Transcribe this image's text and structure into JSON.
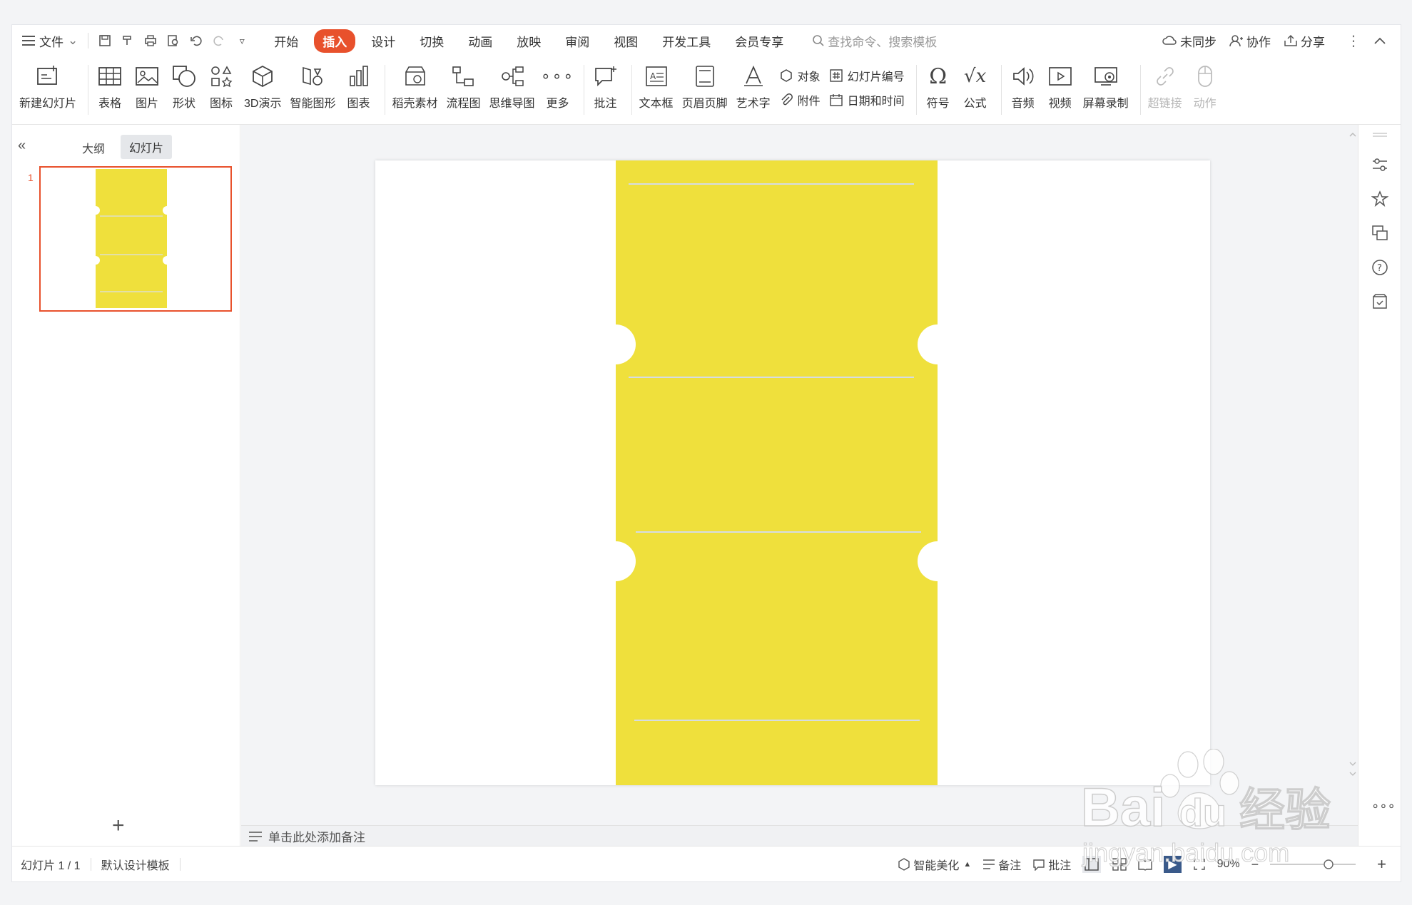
{
  "menubar": {
    "file_label": "文件",
    "tabs": [
      "开始",
      "插入",
      "设计",
      "切换",
      "动画",
      "放映",
      "审阅",
      "视图",
      "开发工具",
      "会员专享"
    ],
    "active_tab": "插入",
    "search_placeholder": "查找命令、搜索模板",
    "right": {
      "sync": "未同步",
      "collab": "协作",
      "share": "分享"
    }
  },
  "ribbon": {
    "new_slide": "新建幻灯片",
    "table": "表格",
    "picture": "图片",
    "shape": "形状",
    "icon": "图标",
    "three_d": "3D演示",
    "smart_graphic": "智能图形",
    "chart": "图表",
    "material": "稻壳素材",
    "flowchart": "流程图",
    "mindmap": "思维导图",
    "more": "更多",
    "comment": "批注",
    "textbox": "文本框",
    "header_footer": "页眉页脚",
    "wordart": "艺术字",
    "object": "对象",
    "slide_number": "幻灯片编号",
    "attachment": "附件",
    "datetime": "日期和时间",
    "symbol": "符号",
    "formula": "公式",
    "audio": "音频",
    "video": "视频",
    "screen_record": "屏幕录制",
    "hyperlink": "超链接",
    "action": "动作"
  },
  "leftpanel": {
    "tab_outline": "大纲",
    "tab_slides": "幻灯片",
    "slide_number": "1",
    "add_symbol": "+"
  },
  "notes": {
    "placeholder": "单击此处添加备注"
  },
  "statusbar": {
    "slide_info": "幻灯片 1 / 1",
    "template": "默认设计模板",
    "beautify": "智能美化",
    "notes": "备注",
    "comment": "批注",
    "zoom": "90%"
  },
  "watermark": {
    "line1": "Bai",
    "line2": "du",
    "line3": "经验",
    "url": "jingyan.baidu.com"
  },
  "colors": {
    "accent": "#e8512c",
    "ticket_yellow": "#efe03c"
  }
}
